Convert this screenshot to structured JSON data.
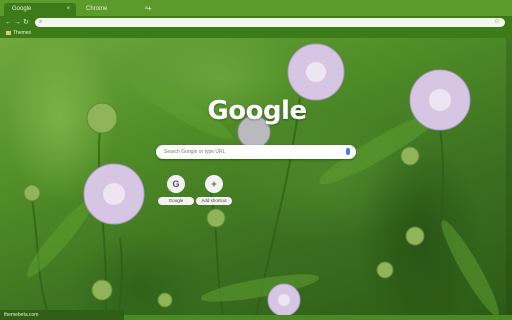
{
  "tabs": [
    {
      "label": "Google",
      "active": true
    },
    {
      "label": "Chrome",
      "active": false
    }
  ],
  "tab_close_glyph": "×",
  "tab_new_glyph": "+",
  "toolbar": {
    "back_icon": "arrow-left-icon",
    "forward_icon": "arrow-right-icon",
    "reload_icon": "reload-icon",
    "omnibox_value": "",
    "omnibox_icon": "search-icon",
    "star_icon": "star-icon"
  },
  "bookmarks": [
    {
      "label": "Themes",
      "icon": "folder-icon"
    }
  ],
  "ntp": {
    "logo_text": "Google",
    "search_placeholder": "Search Google or type URL",
    "mic_icon": "mic-icon",
    "shortcuts": [
      {
        "initial": "G",
        "label": "Google"
      },
      {
        "initial": "+",
        "label": "Add shortcut"
      }
    ]
  },
  "status": {
    "url": "themebeta.com"
  },
  "colors": {
    "frame": "#3d7a1a",
    "tabstrip": "#5c9a2c",
    "accent": "#4a7cf0"
  }
}
